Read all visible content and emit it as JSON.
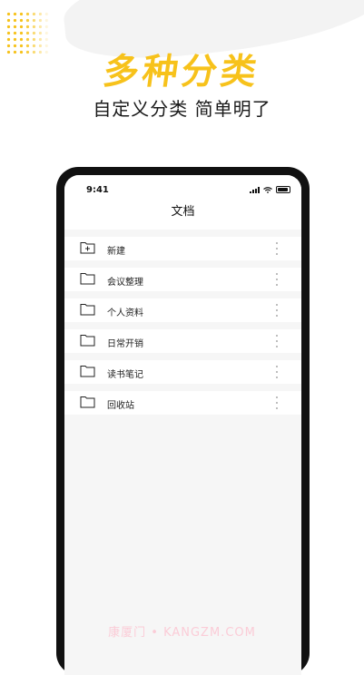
{
  "promo": {
    "headline": "多种分类",
    "subline": "自定义分类 简单明了",
    "accent_color": "#f7c21b"
  },
  "statusbar": {
    "time": "9:41",
    "icons": [
      "signal-icon",
      "wifi-icon",
      "battery-icon"
    ]
  },
  "screen": {
    "title": "文档"
  },
  "folders": [
    {
      "label": "新建",
      "icon": "folder-add-icon"
    },
    {
      "label": "会议整理",
      "icon": "folder-icon"
    },
    {
      "label": "个人资料",
      "icon": "folder-icon"
    },
    {
      "label": "日常开销",
      "icon": "folder-icon"
    },
    {
      "label": "读书笔记",
      "icon": "folder-icon"
    },
    {
      "label": "回收站",
      "icon": "folder-icon"
    }
  ],
  "watermark": "康厦门 • KANGZM.COM"
}
